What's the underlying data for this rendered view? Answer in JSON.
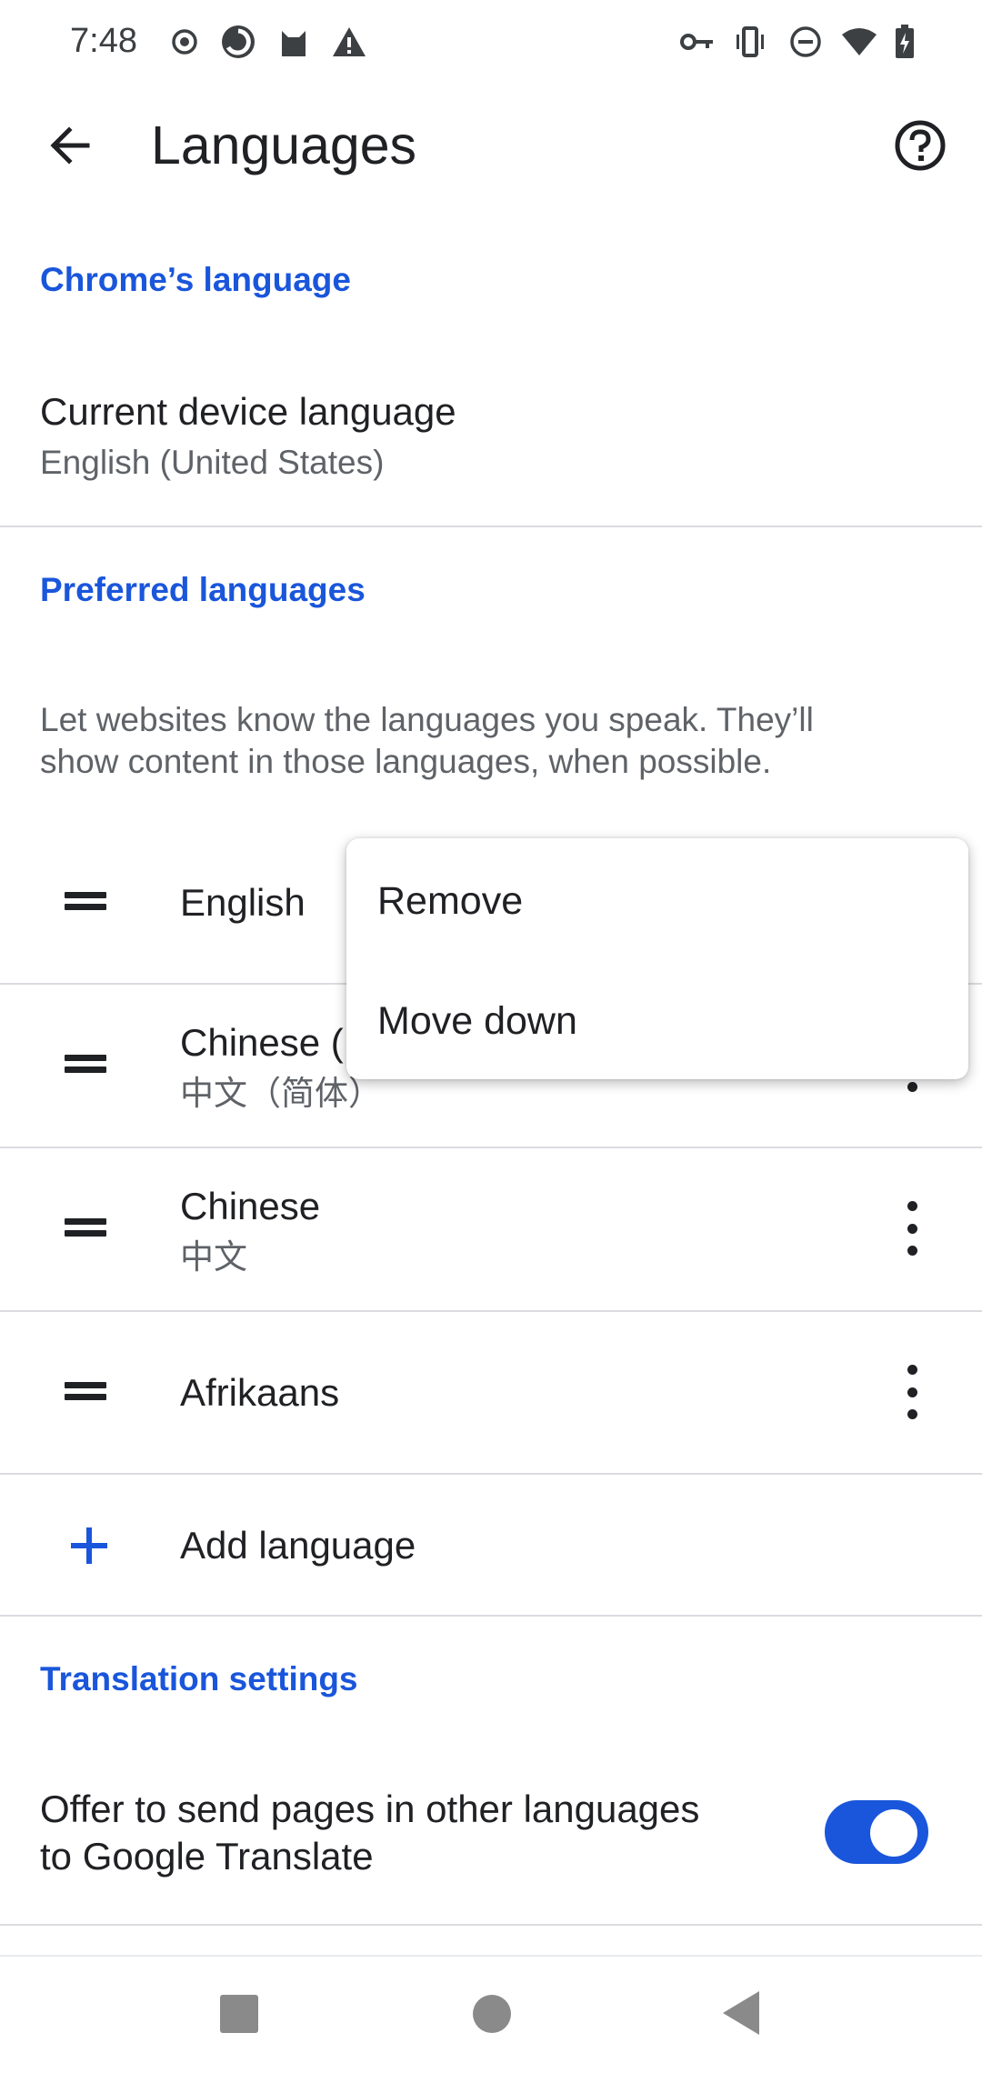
{
  "status_bar": {
    "time": "7:48",
    "left_icons": [
      "record-icon",
      "data-saver-icon",
      "cat-icon",
      "warning-icon"
    ],
    "right_icons": [
      "vpn-key-icon",
      "vibrate-icon",
      "do-not-disturb-icon",
      "wifi-icon",
      "battery-charging-icon"
    ]
  },
  "toolbar": {
    "title": "Languages",
    "back_icon": "arrow-back-icon",
    "help_icon": "help-icon"
  },
  "chrome_language": {
    "header": "Chrome’s language",
    "title": "Current device language",
    "value": "English (United States)"
  },
  "preferred_languages": {
    "header": "Preferred languages",
    "description_line1": "Let websites know the languages you speak. They’ll",
    "description_line2": "show content in those languages, when possible.",
    "items": [
      {
        "name": "English",
        "native": ""
      },
      {
        "name": "Chinese (",
        "native": "中文（简体）"
      },
      {
        "name": "Chinese",
        "native": "中文"
      },
      {
        "name": "Afrikaans",
        "native": ""
      }
    ],
    "add_label": "Add language"
  },
  "context_menu": {
    "items": [
      "Remove",
      "Move down"
    ]
  },
  "translation": {
    "header": "Translation settings",
    "offer_line1": "Offer to send pages in other languages",
    "offer_line2": "to Google Translate",
    "toggle_on": true
  },
  "nav_bar": {
    "icons": [
      "recents-square-icon",
      "home-circle-icon",
      "back-triangle-icon"
    ]
  },
  "colors": {
    "accent": "#1a56db",
    "text_primary": "#202124",
    "text_secondary": "#5f6368",
    "divider": "#dadce0"
  }
}
